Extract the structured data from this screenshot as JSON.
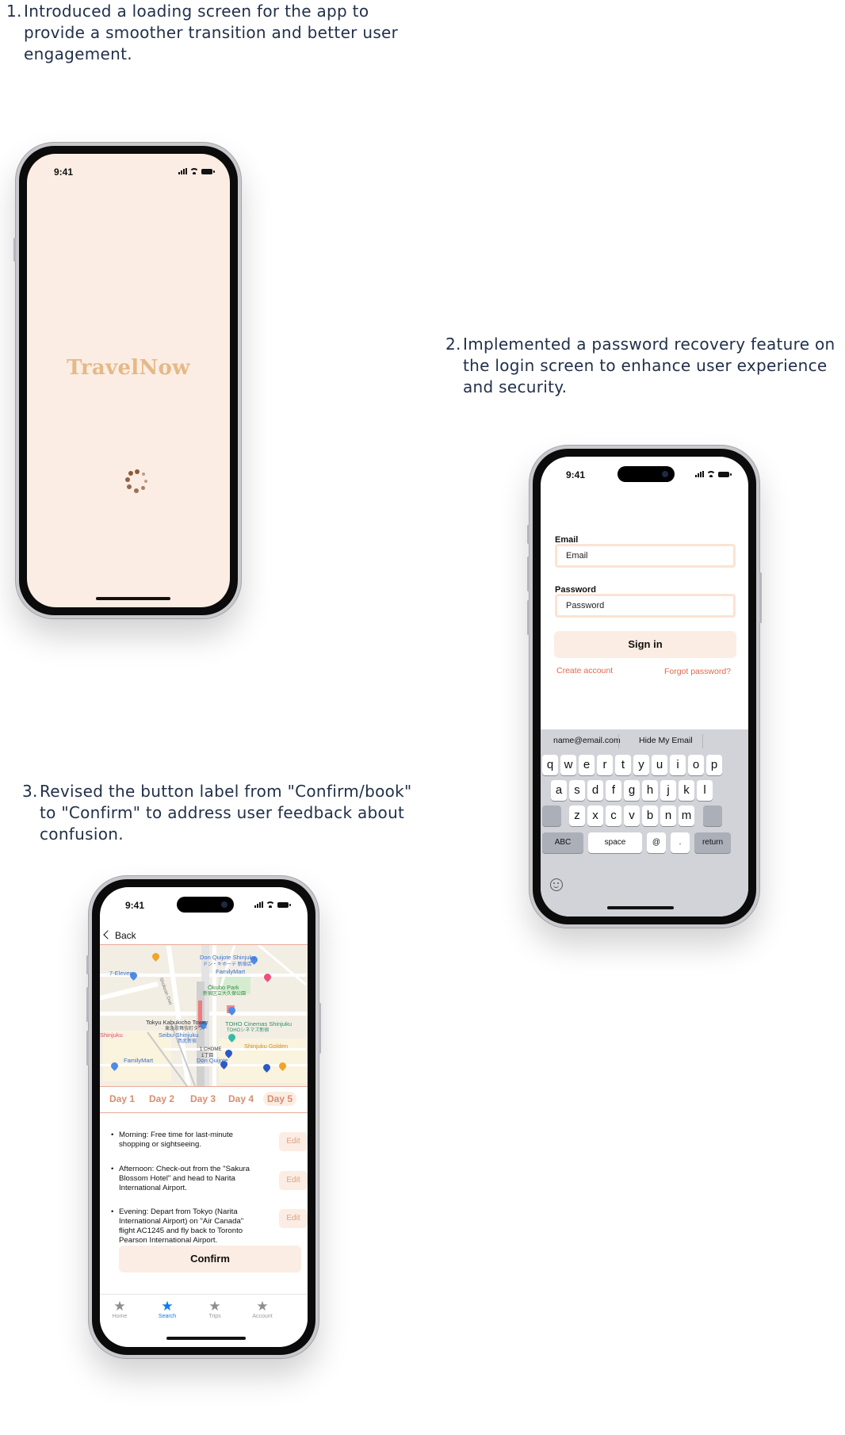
{
  "notes": [
    {
      "num": "1.",
      "text": "Introduced a loading screen for the app to provide a smoother transition and better user engagement."
    },
    {
      "num": "2.",
      "text": "Implemented a password recovery feature on the login screen to enhance user experience and security."
    },
    {
      "num": "3.",
      "text": "Revised the button label from \"Confirm/book\" to \"Confirm\" to address user feedback about confusion."
    }
  ],
  "loading_screen": {
    "time": "9:41",
    "app_name": "TravelNow",
    "background": "#fbede3",
    "brand_color": "#e4b988",
    "spinner_color": "#8b5a3c",
    "spinner_icon": "loading-spinner-icon"
  },
  "login_screen": {
    "time": "9:41",
    "email_label": "Email",
    "email_placeholder": "Email",
    "password_label": "Password",
    "password_placeholder": "Password",
    "sign_in": "Sign in",
    "create_account": "Create account",
    "forgot_password": "Forgot password?",
    "link_color": "#e0694b",
    "keyboard": {
      "suggestions": [
        "name@email.com",
        "Hide My Email"
      ],
      "row1": [
        "q",
        "w",
        "e",
        "r",
        "t",
        "y",
        "u",
        "i",
        "o",
        "p"
      ],
      "row2": [
        "a",
        "s",
        "d",
        "f",
        "g",
        "h",
        "j",
        "k",
        "l"
      ],
      "row3": [
        "z",
        "x",
        "c",
        "v",
        "b",
        "n",
        "m"
      ],
      "abc": "ABC",
      "space": "space",
      "at": "@",
      "dot": ".",
      "return": "return"
    }
  },
  "itinerary_screen": {
    "time": "9:41",
    "back": "Back",
    "map_labels": {
      "don_quijote": "Don Quijote Shinjuku",
      "don_quijote_jp": "ドン・キホーテ 新宿店",
      "seven_eleven": "7-Eleven",
      "familymart_top": "FamilyMart",
      "okubo_park": "Ōkubo Park",
      "okubo_jp": "新宿区立大久保公園",
      "kabukicho_tower": "Tokyu Kabukicho Tower",
      "kabukicho_jp": "東急歌舞伎町タワー",
      "toho": "TOHO Cinemas Shinjuku",
      "toho_jp": "TOHOシネマズ新宿",
      "seibu": "Seibu-Shinjuku",
      "seibu_jp": "西武新宿",
      "shinjuku": "Shinjuku",
      "chome": "1 CHOME",
      "chome_jp": "1丁目",
      "golden": "Shinjuku Golden",
      "familymart_bottom": "FamilyMart",
      "don_quijote_bottom": "Don Quijote",
      "street": "Shokuan Dori"
    },
    "days": [
      "Day 1",
      "Day 2",
      "Day 3",
      "Day 4",
      "Day 5"
    ],
    "active_day": "Day 5",
    "items": [
      {
        "text": "Morning: Free time for last-minute shopping or sightseeing.",
        "action": "Edit"
      },
      {
        "text": "Afternoon: Check-out from the \"Sakura Blossom Hotel\" and head to Narita International Airport.",
        "action": "Edit"
      },
      {
        "text": "Evening: Depart from Tokyo (Narita International Airport) on \"Air Canada\" flight AC1245 and fly back to Toronto Pearson International Airport.",
        "action": "Edit"
      }
    ],
    "confirm": "Confirm",
    "tabs": [
      {
        "label": "Home",
        "icon": "star-icon"
      },
      {
        "label": "Search",
        "icon": "star-icon",
        "active": true
      },
      {
        "label": "Trips",
        "icon": "star-icon"
      },
      {
        "label": "Account",
        "icon": "star-icon"
      }
    ],
    "accent": "#0a7cf0"
  }
}
